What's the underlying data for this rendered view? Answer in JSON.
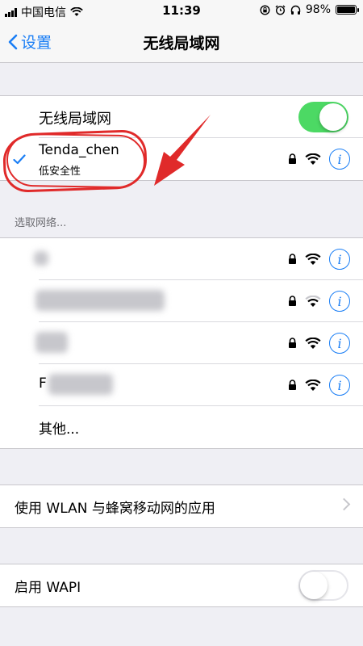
{
  "status": {
    "carrier": "中国电信",
    "time": "11:39",
    "battery_text": "98%",
    "battery_level": 0.98
  },
  "nav": {
    "back_label": "设置",
    "title": "无线局域网"
  },
  "wifi": {
    "toggle_label": "无线局域网",
    "toggle_on": true,
    "connected": {
      "name": "Tenda_chen",
      "subtitle": "低安全性"
    }
  },
  "choose": {
    "header": "选取网络...",
    "networks_visible_text": [
      "",
      "",
      "",
      "F"
    ],
    "other_label": "其他..."
  },
  "wlan_apps": {
    "label": "使用 WLAN 与蜂窝移动网的应用"
  },
  "wapi": {
    "label": "启用 WAPI",
    "toggle_on": false
  },
  "colors": {
    "accent": "#1a7ef5",
    "toggle_on": "#4cd964",
    "annotation": "#e02a2a"
  }
}
